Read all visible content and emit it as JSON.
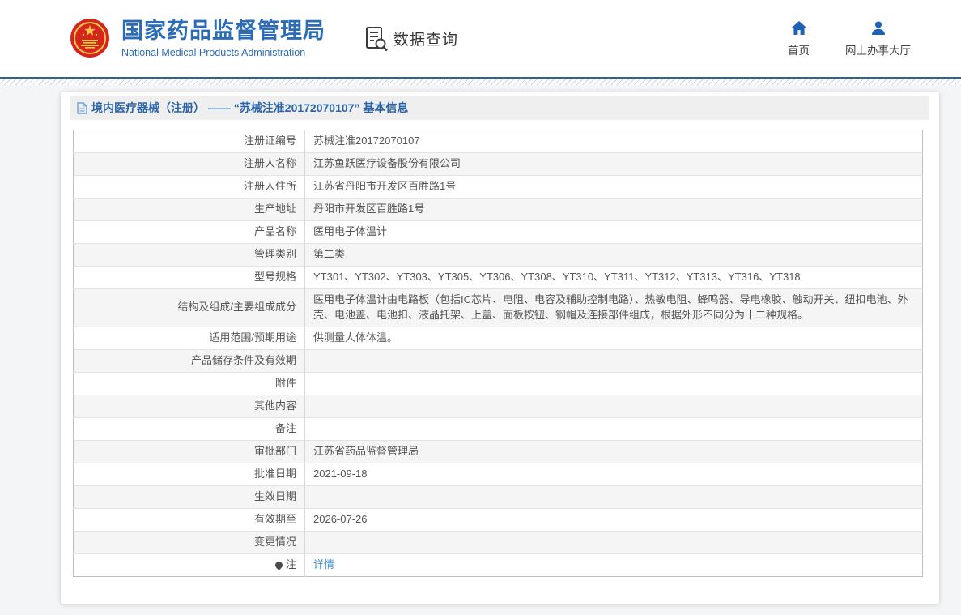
{
  "header": {
    "site_title": "国家药品监督管理局",
    "site_subtitle": "National Medical Products Administration",
    "section_title": "数据查询",
    "nav": {
      "home_label": "首页",
      "hall_label": "网上办事大厅"
    }
  },
  "breadcrumb": {
    "text": "境内医疗器械（注册） —— “苏械注准20172070107” 基本信息"
  },
  "colors": {
    "brand_blue": "#2b6cb8",
    "icon_blue": "#1e62b8",
    "link_blue": "#4393d5",
    "divider_blue": "#2a6496",
    "row_alt_gray": "#f5f5f5",
    "emblem_red": "#d6251f",
    "emblem_gold": "#f7c948"
  },
  "table": {
    "rows": [
      {
        "label": "注册证编号",
        "value": "苏械注准20172070107"
      },
      {
        "label": "注册人名称",
        "value": "江苏鱼跃医疗设备股份有限公司"
      },
      {
        "label": "注册人住所",
        "value": "江苏省丹阳市开发区百胜路1号"
      },
      {
        "label": "生产地址",
        "value": "丹阳市开发区百胜路1号"
      },
      {
        "label": "产品名称",
        "value": "医用电子体温计"
      },
      {
        "label": "管理类别",
        "value": "第二类"
      },
      {
        "label": "型号规格",
        "value": "YT301、YT302、YT303、YT305、YT306、YT308、YT310、YT311、YT312、YT313、YT316、YT318"
      },
      {
        "label": "结构及组成/主要组成成分",
        "value": "医用电子体温计由电路板（包括IC芯片、电阻、电容及辅助控制电路）、热敏电阻、蜂鸣器、导电橡胶、触动开关、纽扣电池、外壳、电池盖、电池扣、液晶托架、上盖、面板按钮、钢帽及连接部件组成，根据外形不同分为十二种规格。"
      },
      {
        "label": "适用范围/预期用途",
        "value": "供测量人体体温。"
      },
      {
        "label": "产品储存条件及有效期",
        "value": ""
      },
      {
        "label": "附件",
        "value": ""
      },
      {
        "label": "其他内容",
        "value": ""
      },
      {
        "label": "备注",
        "value": ""
      },
      {
        "label": "审批部门",
        "value": "江苏省药品监督管理局"
      },
      {
        "label": "批准日期",
        "value": "2021-09-18"
      },
      {
        "label": "生效日期",
        "value": ""
      },
      {
        "label": "有效期至",
        "value": "2026-07-26"
      },
      {
        "label": "变更情况",
        "value": ""
      },
      {
        "label": "注",
        "value": "详情",
        "link": true,
        "label_icon": "bulb-icon"
      }
    ]
  }
}
